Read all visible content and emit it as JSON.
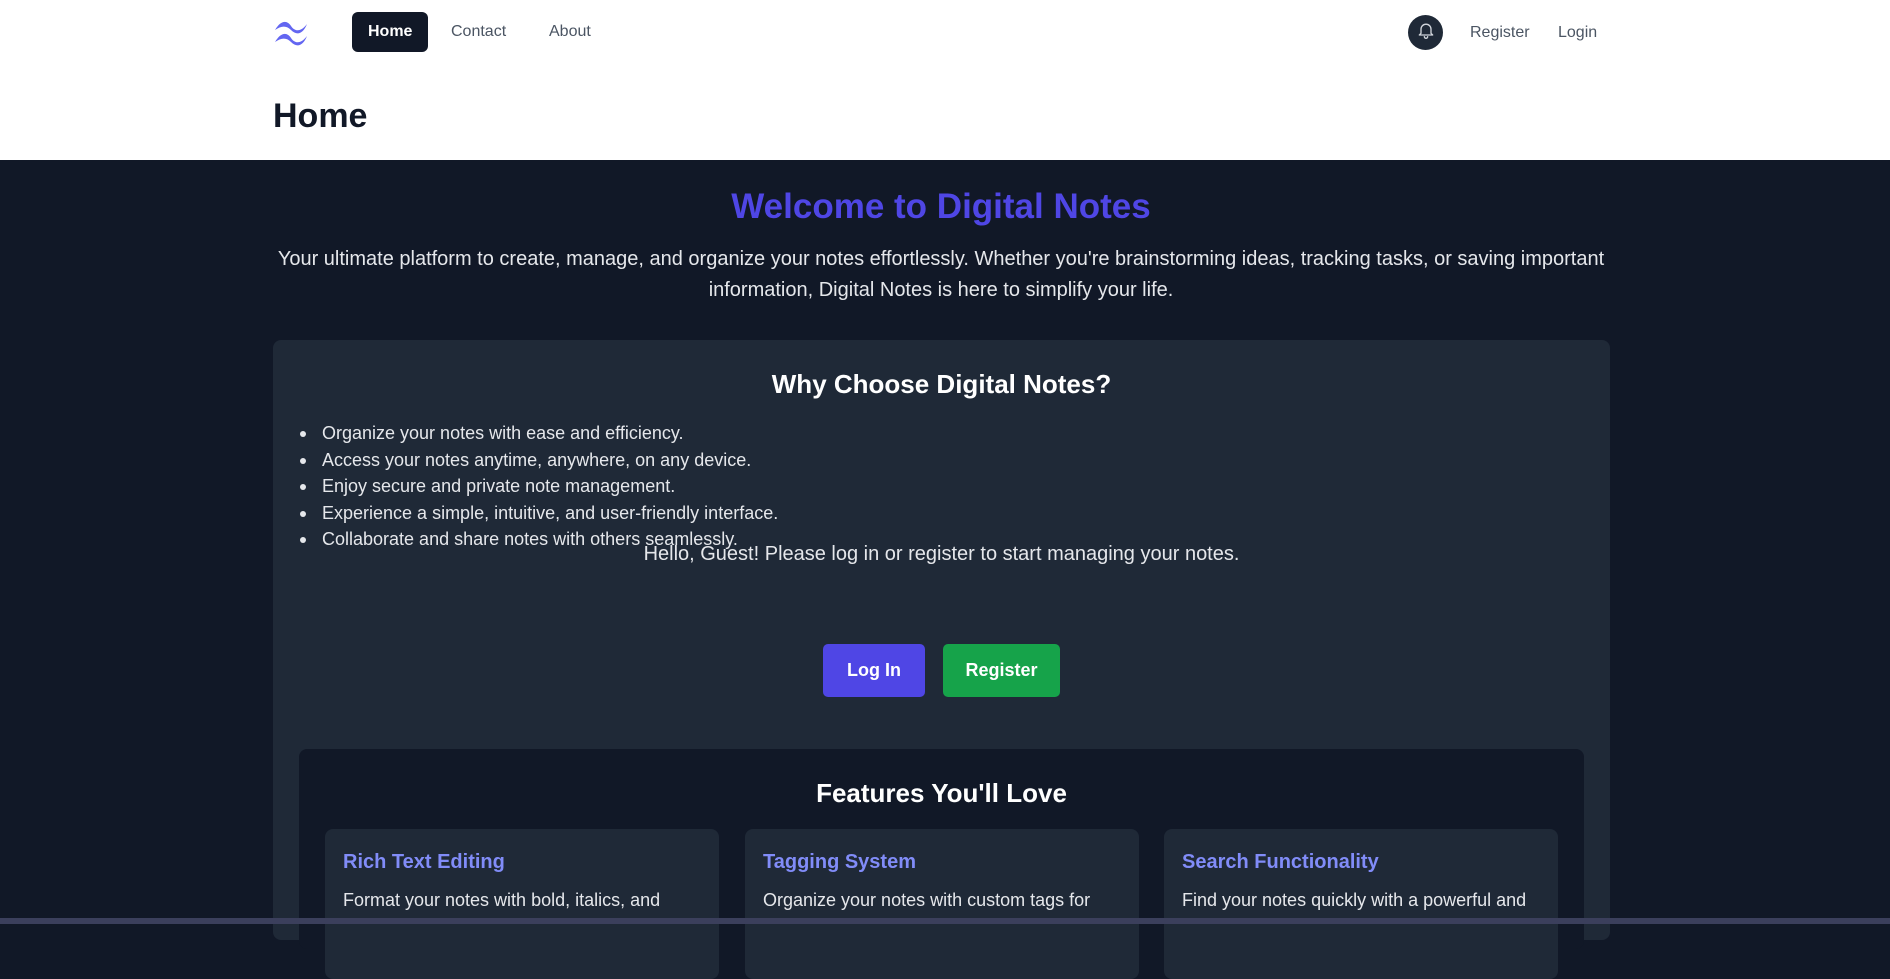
{
  "nav": {
    "links": [
      {
        "label": "Home",
        "active": true
      },
      {
        "label": "Contact",
        "active": false
      },
      {
        "label": "About",
        "active": false
      }
    ],
    "register_label": "Register",
    "login_label": "Login",
    "logo_icon": "wave-logo-icon",
    "notification_icon": "bell-icon"
  },
  "header": {
    "title": "Home"
  },
  "hero": {
    "title": "Welcome to Digital Notes",
    "text": "Your ultimate platform to create, manage, and organize your notes effortlessly. Whether you're brainstorming ideas, tracking tasks, or saving important information, Digital Notes is here to simplify your life."
  },
  "why": {
    "title": "Why Choose Digital Notes?",
    "items": [
      "Organize your notes with ease and efficiency.",
      "Access your notes anytime, anywhere, on any device.",
      "Enjoy secure and private note management.",
      "Experience a simple, intuitive, and user-friendly interface.",
      "Collaborate and share notes with others seamlessly."
    ]
  },
  "guest": {
    "message": "Hello, Guest! Please log in or register to start managing your notes.",
    "login_button": "Log In",
    "register_button": "Register"
  },
  "features": {
    "title": "Features You'll Love",
    "cards": [
      {
        "title": "Rich Text Editing",
        "desc": "Format your notes with bold, italics, and"
      },
      {
        "title": "Tagging System",
        "desc": "Organize your notes with custom tags for"
      },
      {
        "title": "Search Functionality",
        "desc": "Find your notes quickly with a powerful and"
      }
    ]
  },
  "colors": {
    "accent": "#4f46e5",
    "success": "#16a34a",
    "background": "#111827",
    "card": "#1f2937",
    "feature_title": "#818cf8"
  }
}
